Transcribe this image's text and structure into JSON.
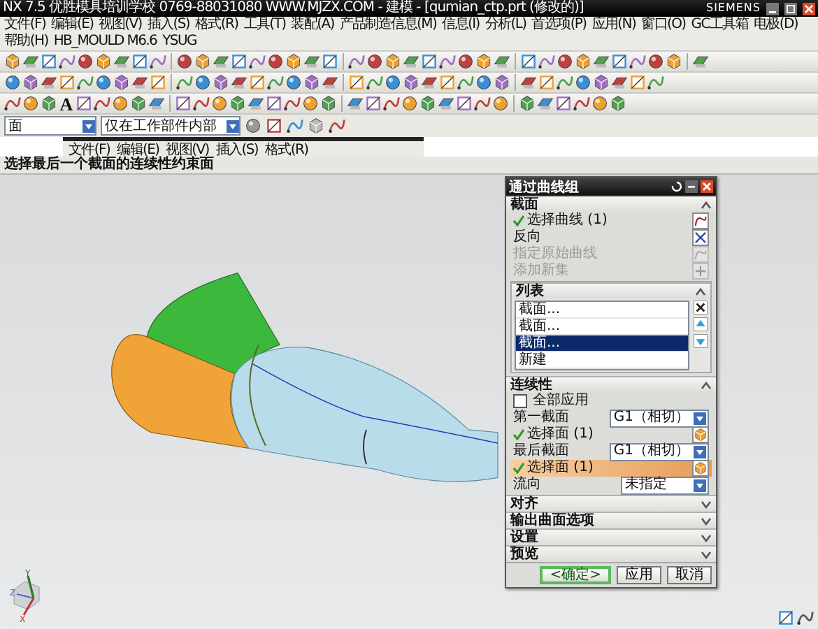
{
  "window": {
    "title": "NX 7.5  优胜模具培训学校  0769-88031080  WWW.MJZX.COM - 建模 - [qumian_ctp.prt (修改的)]",
    "brand": "SIEMENS"
  },
  "menu": [
    "文件(F)",
    "编辑(E)",
    "视图(V)",
    "插入(S)",
    "格式(R)",
    "工具(T)",
    "装配(A)",
    "产品制造信息(M)",
    "信息(I)",
    "分析(L)",
    "首选项(P)",
    "应用(N)",
    "窗口(O)",
    "GC工具箱",
    "电极(D)",
    "帮助(H)",
    "HB_MOULD M6.6",
    "YSUG"
  ],
  "toolbar": {
    "text_tool_glyph": "A"
  },
  "selection_bar": {
    "type_filter": "面",
    "scope": "仅在工作部件内部"
  },
  "embedded_window": {
    "menu": [
      "文件(F)",
      "编辑(E)",
      "视图(V)",
      "插入(S)",
      "格式(R)"
    ]
  },
  "prompt": "选择最后一个截面的连续性约束面",
  "dialog": {
    "title": "通过曲线组",
    "sections": [
      {
        "title": "截面",
        "expanded": true,
        "rows": [
          {
            "kind": "select",
            "label": "选择曲线 (1)",
            "done": true,
            "active": false,
            "disabled": false
          },
          {
            "kind": "action",
            "label": "反向",
            "disabled": false
          },
          {
            "kind": "action",
            "label": "指定原始曲线",
            "disabled": true
          },
          {
            "kind": "action",
            "label": "添加新集",
            "disabled": true
          },
          {
            "kind": "list",
            "title": "列表",
            "expanded": true,
            "items": [
              {
                "label": "截面...",
                "selected": false
              },
              {
                "label": "截面...",
                "selected": false
              },
              {
                "label": "截面...",
                "selected": true
              },
              {
                "label": "新建",
                "selected": false
              }
            ]
          }
        ]
      },
      {
        "title": "连续性",
        "expanded": true,
        "rows": [
          {
            "kind": "checkbox",
            "label": "全部应用",
            "checked": false
          },
          {
            "kind": "dropdown",
            "label": "第一截面",
            "value": "G1（相切）"
          },
          {
            "kind": "select",
            "label": "选择面 (1)",
            "done": true,
            "active": false,
            "disabled": false
          },
          {
            "kind": "dropdown",
            "label": "最后截面",
            "value": "G1（相切）"
          },
          {
            "kind": "select",
            "label": "选择面 (1)",
            "done": true,
            "active": true,
            "disabled": false
          },
          {
            "kind": "dropdown",
            "label": "流向",
            "value": "未指定"
          }
        ]
      },
      {
        "title": "对齐",
        "expanded": false
      },
      {
        "title": "输出曲面选项",
        "expanded": false
      },
      {
        "title": "设置",
        "expanded": false
      },
      {
        "title": "预览",
        "expanded": false
      }
    ],
    "buttons": [
      {
        "label": "<确定>",
        "default": true
      },
      {
        "label": "应用",
        "default": false
      },
      {
        "label": "取消",
        "default": false
      }
    ]
  },
  "triad": {
    "labels": [
      "Z",
      "Y",
      "X"
    ]
  }
}
